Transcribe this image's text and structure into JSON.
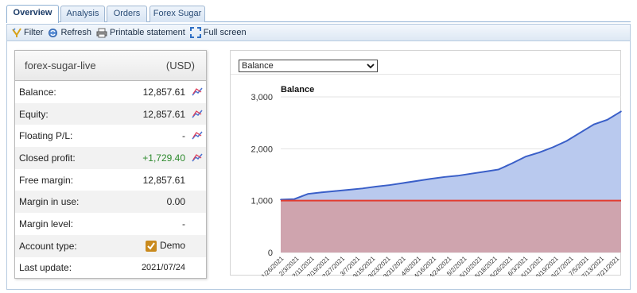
{
  "tabs": [
    {
      "label": "Overview",
      "active": true
    },
    {
      "label": "Analysis"
    },
    {
      "label": "Orders"
    },
    {
      "label": "Forex Sugar"
    }
  ],
  "toolbar": {
    "filter_label": "Filter",
    "refresh_label": "Refresh",
    "print_label": "Printable statement",
    "fullscreen_label": "Full screen"
  },
  "account": {
    "name": "forex-sugar-live",
    "currency": "(USD)",
    "rows": [
      {
        "label": "Balance:",
        "value": "12,857.61"
      },
      {
        "label": "Equity:",
        "value": "12,857.61"
      },
      {
        "label": "Floating P/L:",
        "value": "-"
      },
      {
        "label": "Closed profit:",
        "value": "+1,729.40"
      },
      {
        "label": "Free margin:",
        "value": "12,857.61"
      },
      {
        "label": "Margin in use:",
        "value": "0.00"
      },
      {
        "label": "Margin level:",
        "value": "-"
      },
      {
        "label": "Account type:",
        "value": "Demo"
      },
      {
        "label": "Last update:",
        "value": "2021/07/24"
      }
    ]
  },
  "chart_select": {
    "selected": "Balance"
  },
  "colors": {
    "balance_line": "#3a5fc8",
    "balance_fill": "#b9c9ee",
    "deposit_line": "#e23b2f",
    "deposit_fill": "#cfa4ae",
    "profit_green": "#2e8b2e"
  },
  "chart_data": {
    "type": "area",
    "title": "Balance",
    "ylim": [
      0,
      3000
    ],
    "yticks": [
      "0",
      "1,000",
      "2,000",
      "3,000"
    ],
    "xtick_labels": [
      "1/26/2021",
      "2/3/2021",
      "2/11/2021",
      "2/19/2021",
      "2/27/2021",
      "3/7/2021",
      "3/15/2021",
      "3/23/2021",
      "3/31/2021",
      "4/8/2021",
      "4/16/2021",
      "4/24/2021",
      "5/2/2021",
      "5/10/2021",
      "5/18/2021",
      "5/26/2021",
      "6/3/2021",
      "6/11/2021",
      "6/19/2021",
      "6/27/2021",
      "7/5/2021",
      "7/13/2021",
      "7/21/2021"
    ],
    "series": [
      {
        "name": "Balance",
        "values": [
          1020,
          1030,
          1130,
          1160,
          1185,
          1210,
          1235,
          1270,
          1300,
          1340,
          1380,
          1420,
          1455,
          1480,
          1520,
          1560,
          1600,
          1720,
          1850,
          1930,
          2030,
          2150,
          2310,
          2470,
          2560,
          2720
        ]
      },
      {
        "values": [
          1000,
          1000,
          1000,
          1000,
          1000,
          1000,
          1000,
          1000,
          1000,
          1000,
          1000,
          1000,
          1000,
          1000,
          1000,
          1000,
          1000,
          1000,
          1000,
          1000,
          1000,
          1000,
          1000,
          1000,
          1000,
          1000
        ]
      }
    ]
  }
}
